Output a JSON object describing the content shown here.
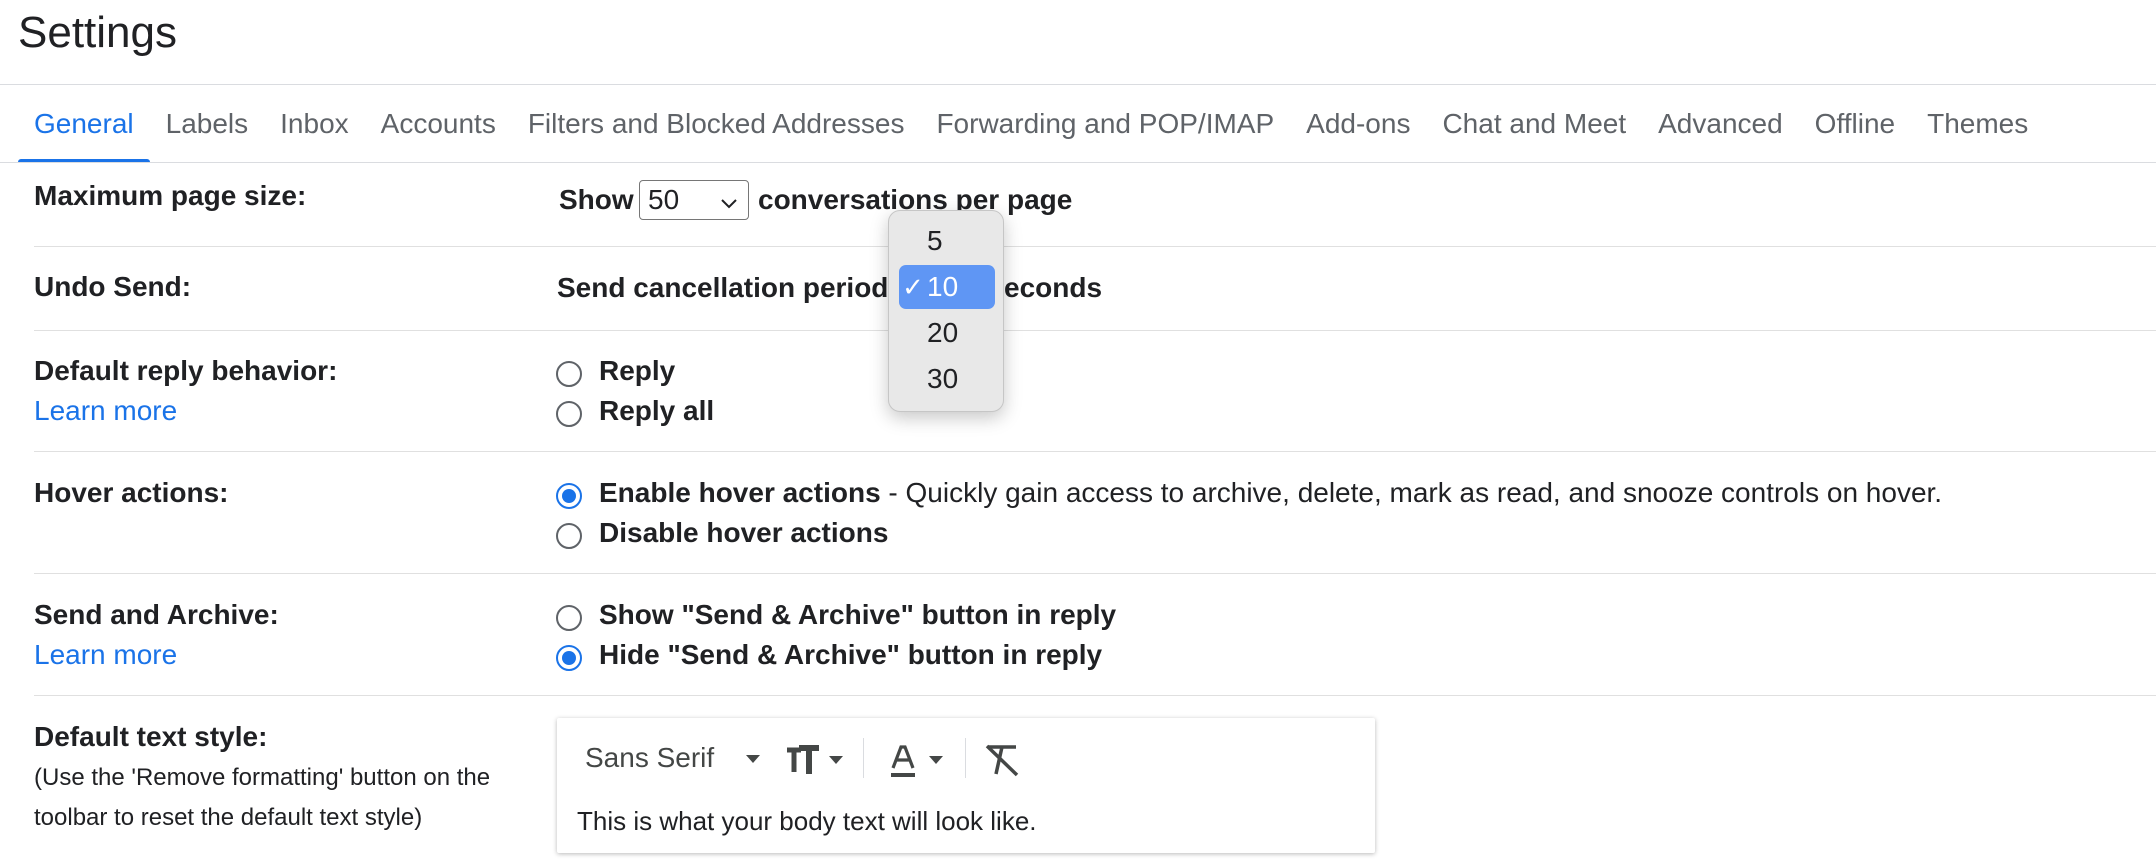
{
  "page_title": "Settings",
  "tabs": [
    {
      "label": "General",
      "active": true
    },
    {
      "label": "Labels"
    },
    {
      "label": "Inbox"
    },
    {
      "label": "Accounts"
    },
    {
      "label": "Filters and Blocked Addresses"
    },
    {
      "label": "Forwarding and POP/IMAP"
    },
    {
      "label": "Add-ons"
    },
    {
      "label": "Chat and Meet"
    },
    {
      "label": "Advanced"
    },
    {
      "label": "Offline"
    },
    {
      "label": "Themes"
    }
  ],
  "max_page_size": {
    "label": "Maximum page size:",
    "prefix": "Show",
    "selected_value": "50",
    "suffix": "conversations per page"
  },
  "undo_send": {
    "label": "Undo Send:",
    "prefix": "Send cancellation period",
    "suffix_visible": "econds",
    "dropdown": {
      "options": [
        "5",
        "10",
        "20",
        "30"
      ],
      "selected": "10",
      "check_glyph": "✓"
    }
  },
  "default_reply": {
    "label": "Default reply behavior:",
    "learn_more": "Learn more",
    "options": [
      {
        "label": "Reply",
        "checked": false
      },
      {
        "label": "Reply all",
        "checked": false
      }
    ]
  },
  "hover_actions": {
    "label": "Hover actions:",
    "options": [
      {
        "label": "Enable hover actions",
        "description": " - Quickly gain access to archive, delete, mark as read, and snooze controls on hover.",
        "checked": true
      },
      {
        "label": "Disable hover actions",
        "checked": false
      }
    ]
  },
  "send_and_archive": {
    "label": "Send and Archive:",
    "learn_more": "Learn more",
    "options": [
      {
        "label": "Show \"Send & Archive\" button in reply",
        "checked": false
      },
      {
        "label": "Hide \"Send & Archive\" button in reply",
        "checked": true
      }
    ]
  },
  "default_text_style": {
    "label": "Default text style:",
    "note": "(Use the 'Remove formatting' button on the toolbar to reset the default text style)",
    "font_name": "Sans Serif",
    "preview": "This is what your body text will look like.",
    "toolbar_icons": [
      "font-size-icon",
      "text-color-icon",
      "remove-formatting-icon"
    ]
  },
  "colors": {
    "accent": "#1a73e8",
    "popup_selected": "#5f96f4"
  }
}
